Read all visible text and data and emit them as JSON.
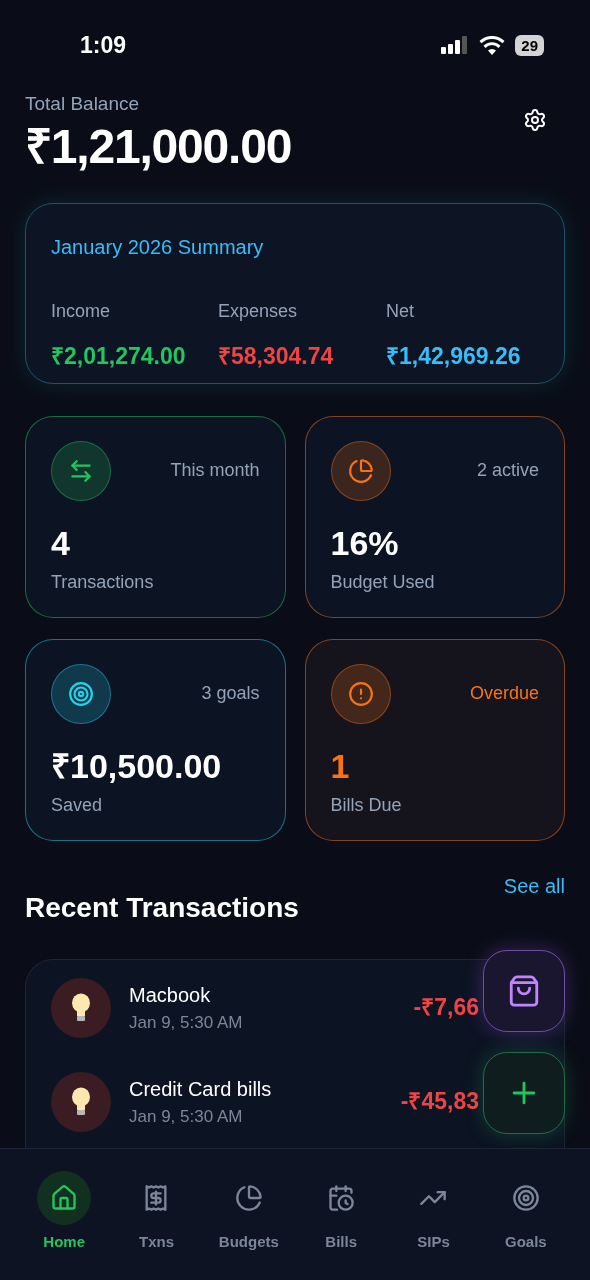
{
  "status_bar": {
    "time": "1:09",
    "battery": "29"
  },
  "balance": {
    "label": "Total Balance",
    "amount": "₹1,21,000.00"
  },
  "summary": {
    "title": "January 2026 Summary",
    "items": [
      {
        "label": "Income",
        "value": "₹2,01,274.00",
        "color": "#22c55e"
      },
      {
        "label": "Expenses",
        "value": "₹58,304.74",
        "color": "#ef4444"
      },
      {
        "label": "Net",
        "value": "₹1,42,969.26",
        "color": "#38bdf8"
      }
    ]
  },
  "stats": [
    {
      "kind": "transactions",
      "tag": "This month",
      "value": "4",
      "label": "Transactions",
      "color": "#22c55e",
      "highlight": false
    },
    {
      "kind": "budget",
      "tag": "2 active",
      "value": "16%",
      "label": "Budget Used",
      "color": "#f97316",
      "highlight": false
    },
    {
      "kind": "goals",
      "tag": "3 goals",
      "value": "₹10,500.00",
      "label": "Saved",
      "color": "#22d3ee",
      "highlight": false
    },
    {
      "kind": "bills",
      "tag": "Overdue",
      "value": "1",
      "label": "Bills Due",
      "color": "#f97316",
      "highlight": true
    }
  ],
  "recent": {
    "title": "Recent Transactions",
    "link": "See all",
    "items": [
      {
        "name": "Macbook",
        "date": "Jan 9, 5:30 AM",
        "amount": "-₹7,66"
      },
      {
        "name": "Credit Card bills",
        "date": "Jan 9, 5:30 AM",
        "amount": "-₹45,83"
      }
    ]
  },
  "fabs": [
    {
      "kind": "bag"
    },
    {
      "kind": "add"
    }
  ],
  "nav": [
    {
      "kind": "home",
      "label": "Home",
      "selected": true
    },
    {
      "kind": "txns",
      "label": "Txns",
      "selected": false
    },
    {
      "kind": "budgets",
      "label": "Budgets",
      "selected": false
    },
    {
      "kind": "bills",
      "label": "Bills",
      "selected": false
    },
    {
      "kind": "sips",
      "label": "SIPs",
      "selected": false
    },
    {
      "kind": "goals",
      "label": "Goals",
      "selected": false
    }
  ]
}
